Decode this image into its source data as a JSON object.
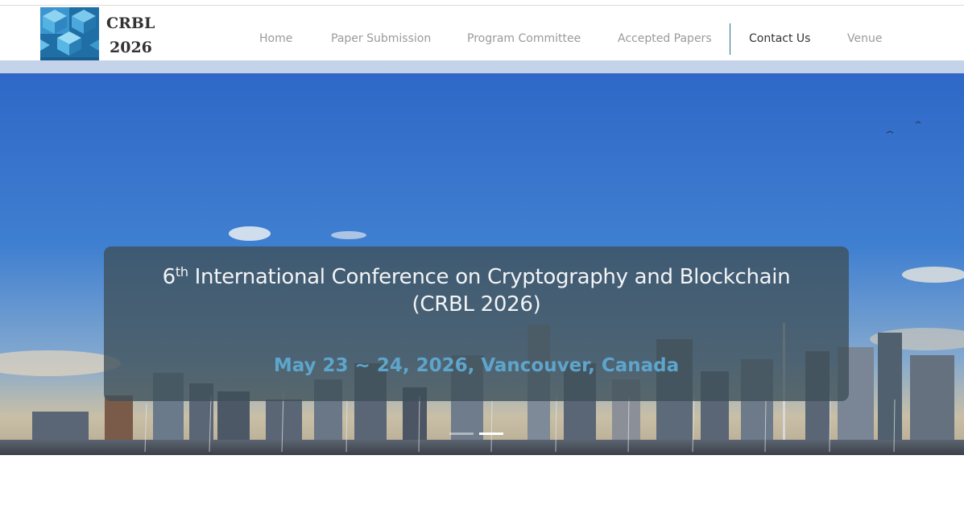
{
  "brand": {
    "line1": "CRBL",
    "line2": "2026"
  },
  "nav": {
    "items": [
      {
        "label": "Home"
      },
      {
        "label": "Paper Submission"
      },
      {
        "label": "Program Committee"
      },
      {
        "label": "Accepted Papers"
      },
      {
        "label": "Contact Us"
      },
      {
        "label": "Venue"
      }
    ],
    "active": "Contact Us"
  },
  "hero": {
    "ordinal": "6",
    "ordinal_suffix": "th",
    "title_rest": " International Conference on Cryptography and Blockchain",
    "title_line2": "(CRBL 2026)",
    "subtitle": "May 23 ~ 24, 2026, Vancouver, Canada"
  },
  "carousel": {
    "slides": 2,
    "active_index": 1
  },
  "colors": {
    "sky_top": "#2f68c8",
    "caption_bg": "#3e5058",
    "subtitle": "#5ea5cc",
    "accent_sep": "#2c6c8a",
    "band": "#c5d3ea"
  }
}
